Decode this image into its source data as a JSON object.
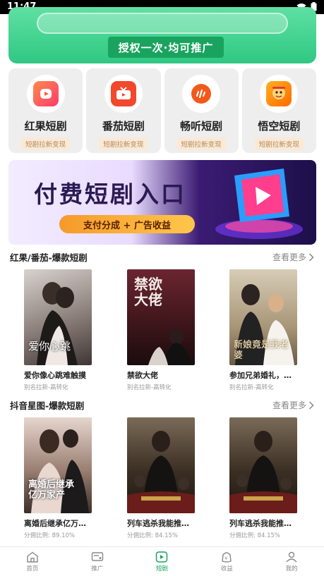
{
  "status_bar": {
    "time": "11:47"
  },
  "hero": {
    "pill_text": "授权一次·均可推广"
  },
  "apps": [
    {
      "name": "红果短剧",
      "tag": "短剧拉新变现",
      "color": "#ff5a3c",
      "icon": "hongguo-app-icon"
    },
    {
      "name": "番茄短剧",
      "tag": "短剧拉新变现",
      "color": "#f2482b",
      "icon": "fanqie-app-icon"
    },
    {
      "name": "畅听短剧",
      "tag": "短剧拉新变现",
      "color": "#f25a1c",
      "icon": "changting-app-icon"
    },
    {
      "name": "悟空短剧",
      "tag": "短剧拉新变现",
      "color": "#ff8a00",
      "icon": "wukong-app-icon"
    }
  ],
  "banner": {
    "title": "付费短剧入口",
    "tagline": "支付分成 + 广告收益"
  },
  "sections": [
    {
      "title": "红果/番茄-爆款短剧",
      "more": "查看更多",
      "items": [
        {
          "title": "爱你像心跳难触摸",
          "sub": "别名拉新-高转化",
          "poster_text": "爱你心跳",
          "bg": "#a89d9a"
        },
        {
          "title": "禁欲大佬",
          "sub": "别名拉新-高转化",
          "poster_text": "禁欲大佬",
          "bg": "#4a1f24"
        },
        {
          "title": "参加兄弟婚礼，新...",
          "sub": "别名拉新-高转化",
          "poster_text": "新娘竟是我老婆",
          "bg": "#b9a98e"
        }
      ]
    },
    {
      "title": "抖音星图-爆款短剧",
      "more": "查看更多",
      "items": [
        {
          "title": "离婚后继承亿万家...",
          "sub": "分佣比例: 89.10%",
          "poster_text": "离婚后继承亿万家产",
          "bg": "#6e5a52"
        },
        {
          "title": "列车逃杀我能推演...",
          "sub": "分佣比例: 84.15%",
          "poster_text": "",
          "bg": "#5a4634"
        },
        {
          "title": "列车逃杀我能推演...",
          "sub": "分佣比例: 84.15%",
          "poster_text": "",
          "bg": "#5a4634"
        }
      ]
    }
  ],
  "tabbar": [
    {
      "label": "首页",
      "icon": "home-icon",
      "active": false
    },
    {
      "label": "推广",
      "icon": "promote-icon",
      "active": false
    },
    {
      "label": "短剧",
      "icon": "play-icon",
      "active": true
    },
    {
      "label": "收益",
      "icon": "earnings-icon",
      "active": false
    },
    {
      "label": "我的",
      "icon": "profile-icon",
      "active": false
    }
  ],
  "colors": {
    "brand_green": "#1aa35f",
    "active_tab": "#1aa35f"
  }
}
